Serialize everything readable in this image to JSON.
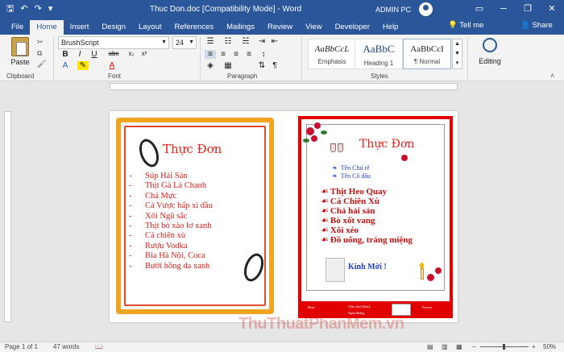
{
  "titlebar": {
    "document_title": "Thuc Don.doc [Compatibility Mode]  -  Word",
    "user": "ADMIN PC"
  },
  "tabs": [
    "File",
    "Home",
    "Insert",
    "Design",
    "Layout",
    "References",
    "Mailings",
    "Review",
    "View",
    "Developer",
    "Help"
  ],
  "tell_me": "Tell me",
  "share": "Share",
  "ribbon": {
    "paste_label": "Paste",
    "font_name": "BrushScript",
    "font_size": "24",
    "group_clipboard": "Clipboard",
    "group_font": "Font",
    "group_paragraph": "Paragraph",
    "group_styles": "Styles",
    "styles": [
      {
        "sample": "AaBbCcL",
        "name": "Emphasis"
      },
      {
        "sample": "AaBbC",
        "name": "Heading 1"
      },
      {
        "sample": "AaBbCcI",
        "name": "¶ Normal"
      }
    ],
    "editing_label": "Editing"
  },
  "left_menu": {
    "title": "Thực Đơn",
    "items": [
      "Súp Hải Sản",
      "Thịt Gà Lá Chanh",
      "Chả Mực",
      "Cá Vược hấp xì dầu",
      "Xôi Ngũ sắc",
      "Thịt bò xào lơ xanh",
      "Cá chiên xù",
      "Rượu Vodka",
      "Bia Hà Nội, Coca",
      "Bưởi hồng da xanh"
    ]
  },
  "right_menu": {
    "title": "Thực Đơn",
    "groom": "Tên Chú rể",
    "bride": "Tên Cô dâu",
    "items": [
      "Thịt Heo Quay",
      "Cá Chiên Xù",
      "Chả hải sản",
      "Bò xốt vang",
      "Xôi xéo",
      "Đồ uống, tráng miệng"
    ],
    "welcome": "Kính Mời !",
    "footer": [
      "Mom",
      "Chúc Quý Khách",
      "Ngon Miệng",
      "Forever"
    ]
  },
  "statusbar": {
    "page": "Page 1 of 1",
    "words": "47 words",
    "zoom": "50%"
  },
  "watermark": "ThuThuatPhanMem.vn"
}
